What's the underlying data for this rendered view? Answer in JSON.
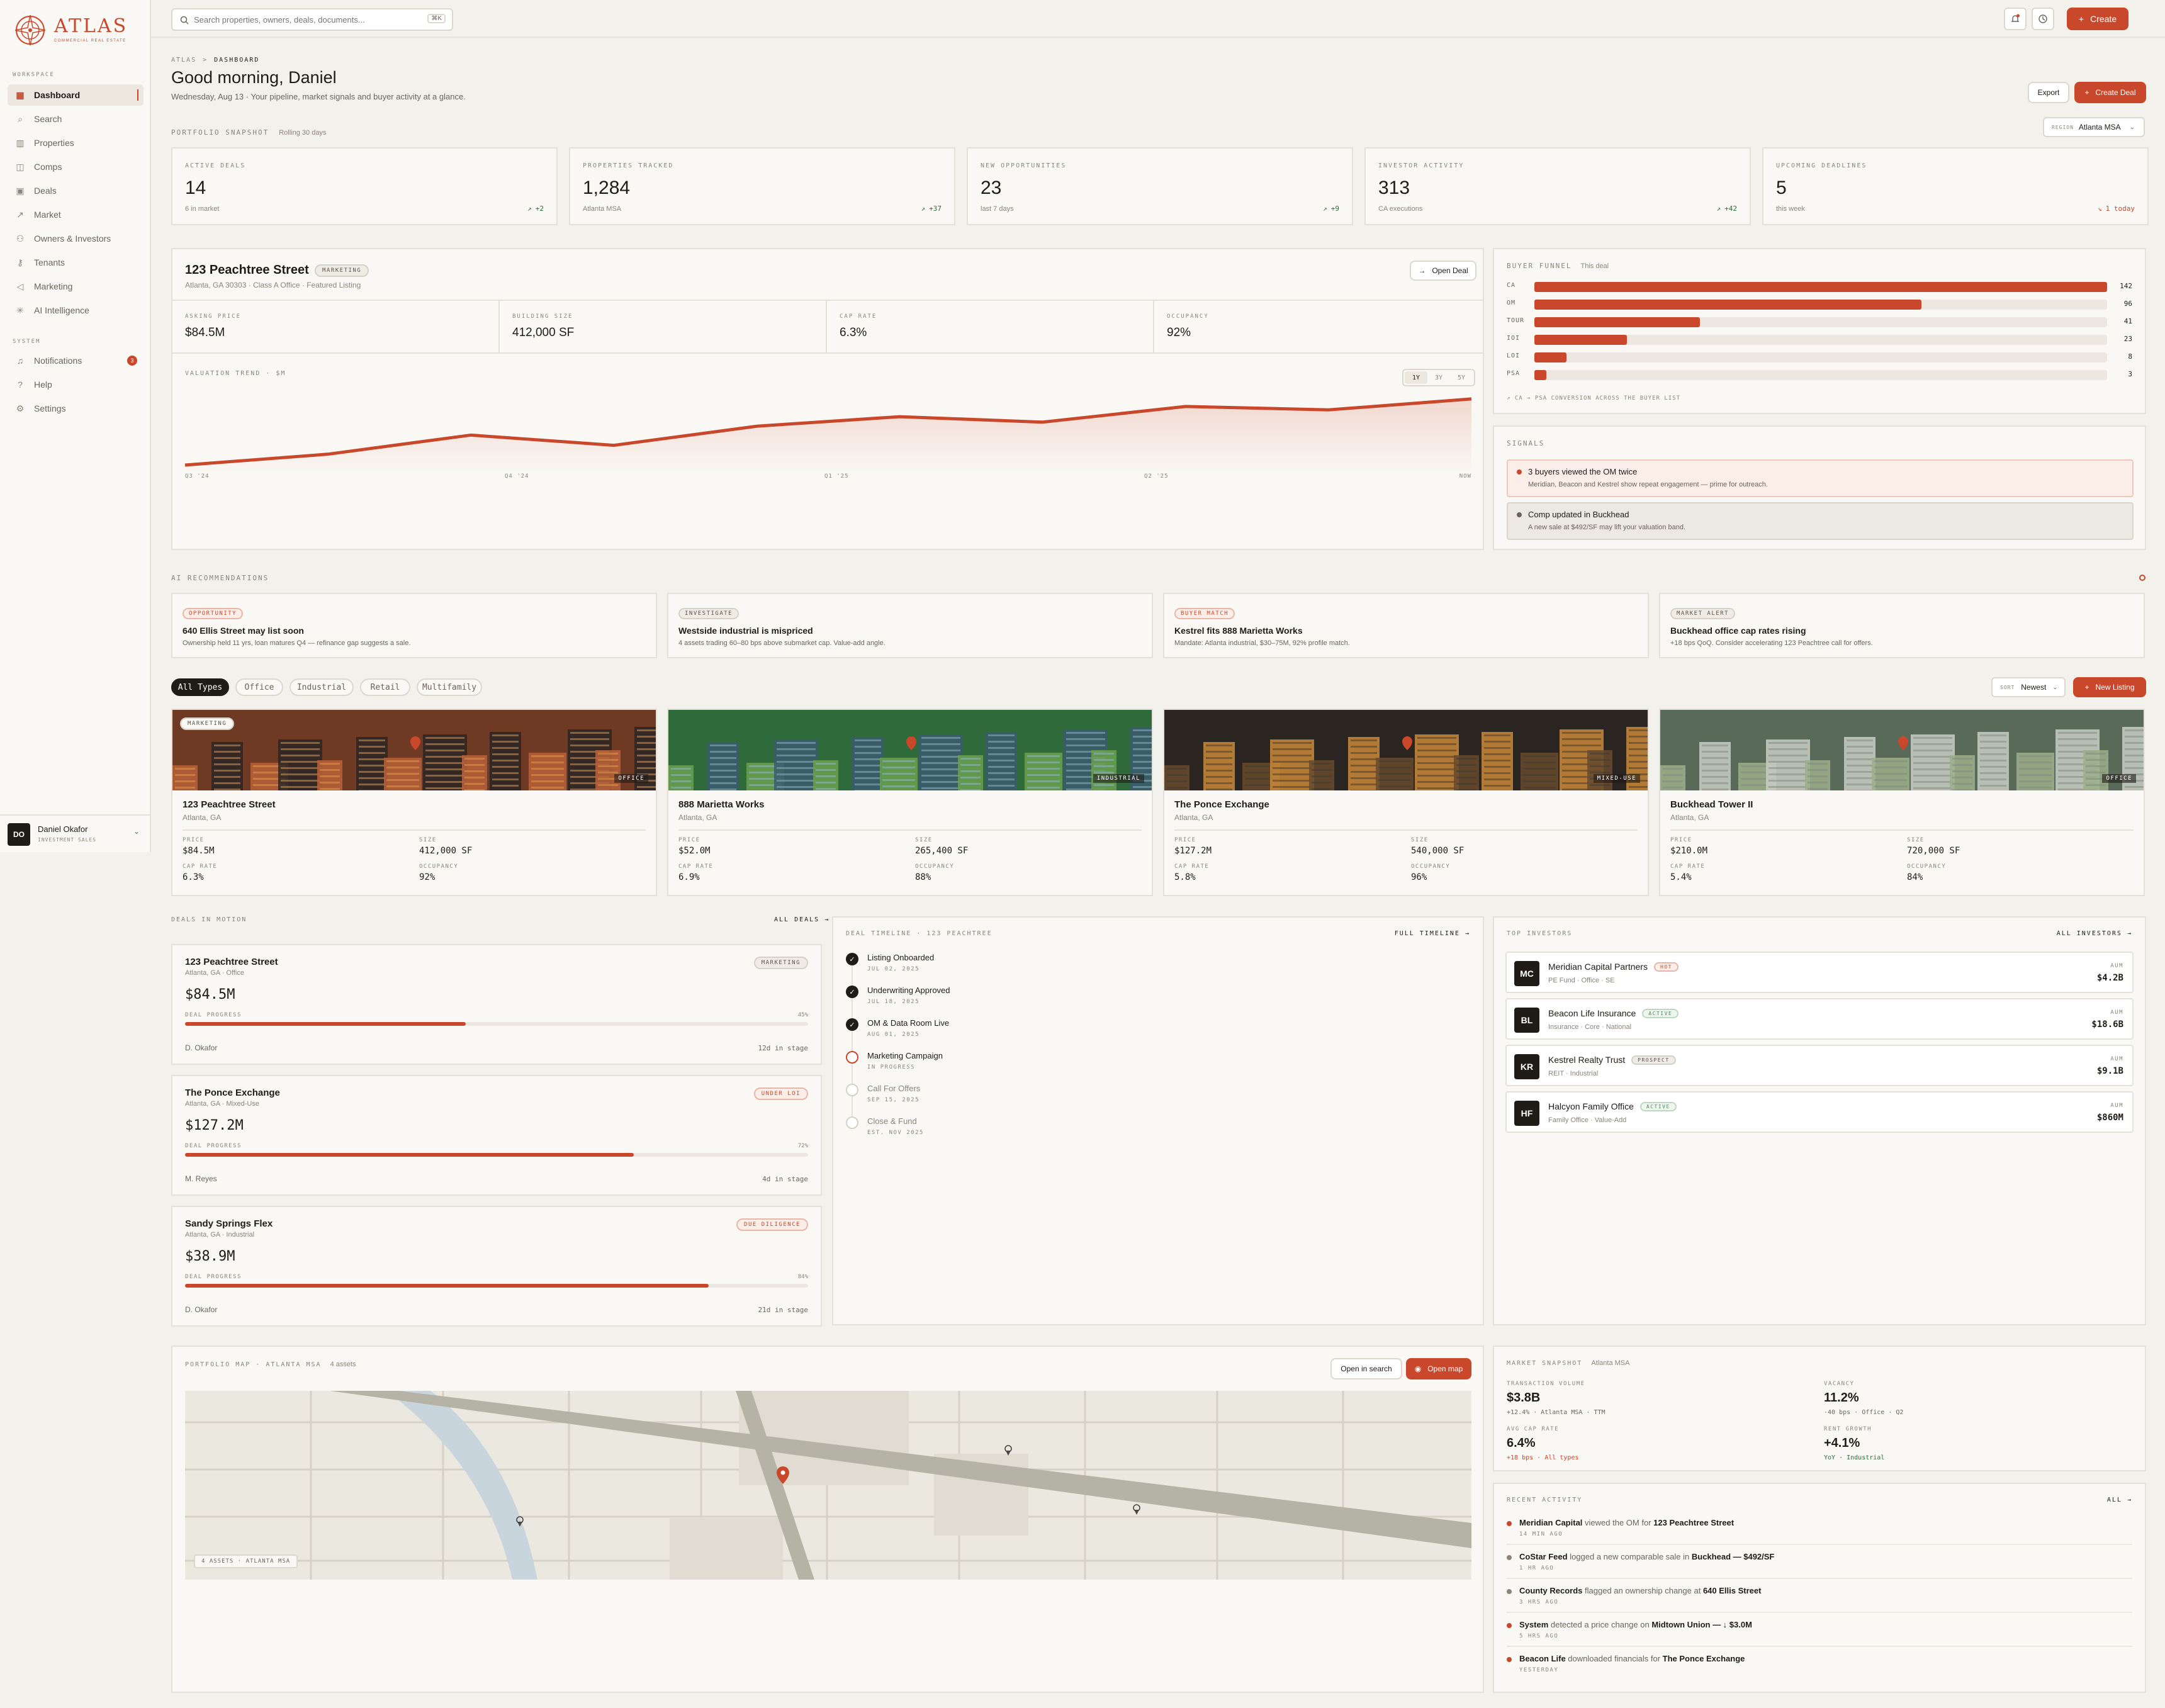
{
  "brand": {
    "name": "ATLAS",
    "tagline": "COMMERCIAL REAL ESTATE"
  },
  "search": {
    "placeholder": "Search properties, owners, deals, documents...",
    "shortcut": "⌘K"
  },
  "topbar": {
    "create_label": "Create"
  },
  "sidebar": {
    "workspace_label": "WORKSPACE",
    "items": [
      {
        "label": "Dashboard",
        "icon": "grid-icon"
      },
      {
        "label": "Search",
        "icon": "search-icon"
      },
      {
        "label": "Properties",
        "icon": "building-icon"
      },
      {
        "label": "Comps",
        "icon": "layers-icon"
      },
      {
        "label": "Deals",
        "icon": "briefcase-icon"
      },
      {
        "label": "Market",
        "icon": "trend-icon"
      },
      {
        "label": "Owners & Investors",
        "icon": "users-icon"
      },
      {
        "label": "Tenants",
        "icon": "key-icon"
      },
      {
        "label": "Marketing",
        "icon": "megaphone-icon"
      },
      {
        "label": "AI Intelligence",
        "icon": "sparkle-icon"
      }
    ],
    "system_label": "SYSTEM",
    "system_items": [
      {
        "label": "Notifications",
        "icon": "bell-icon",
        "badge": "3"
      },
      {
        "label": "Help",
        "icon": "help-icon"
      },
      {
        "label": "Settings",
        "icon": "gear-icon"
      }
    ],
    "user": {
      "initials": "DO",
      "name": "Daniel Okafor",
      "role": "INVESTMENT SALES"
    }
  },
  "header": {
    "breadcrumb_root": "ATLAS",
    "breadcrumb_sep": ">",
    "breadcrumb_page": "DASHBOARD",
    "title": "Good morning, Daniel",
    "subtitle": "Wednesday, Aug 13 · Your pipeline, market signals and buyer activity at a glance.",
    "export_label": "Export",
    "create_deal_label": "Create Deal"
  },
  "snapshot": {
    "label": "PORTFOLIO SNAPSHOT",
    "sub": "Rolling 30 days",
    "region_label": "REGION",
    "region_value": "Atlanta MSA",
    "kpis": [
      {
        "label": "ACTIVE DEALS",
        "value": "14",
        "sub": "6 in market",
        "delta": "+2",
        "neg": false
      },
      {
        "label": "PROPERTIES TRACKED",
        "value": "1,284",
        "sub": "Atlanta MSA",
        "delta": "+37",
        "neg": false
      },
      {
        "label": "NEW OPPORTUNITIES",
        "value": "23",
        "sub": "last 7 days",
        "delta": "+9",
        "neg": false
      },
      {
        "label": "INVESTOR ACTIVITY",
        "value": "313",
        "sub": "CA executions",
        "delta": "+42",
        "neg": false
      },
      {
        "label": "UPCOMING DEADLINES",
        "value": "5",
        "sub": "this week",
        "delta": "1 today",
        "neg": true
      }
    ]
  },
  "featured": {
    "name": "123 Peachtree Street",
    "status": "MARKETING",
    "address": "Atlanta, GA 30303 · Class A Office · Featured Listing",
    "open_label": "Open Deal",
    "metrics": [
      {
        "label": "ASKING PRICE",
        "value": "$84.5M"
      },
      {
        "label": "BUILDING SIZE",
        "value": "412,000 SF"
      },
      {
        "label": "CAP RATE",
        "value": "6.3%"
      },
      {
        "label": "OCCUPANCY",
        "value": "92%"
      }
    ],
    "trend_label": "VALUATION TREND · $M",
    "ranges": [
      "1Y",
      "3Y",
      "5Y"
    ],
    "x_ticks": [
      "Q3 '24",
      "Q4 '24",
      "Q1 '25",
      "Q2 '25",
      "NOW"
    ]
  },
  "chart_data": {
    "type": "area",
    "title": "VALUATION TREND · $M",
    "x": [
      "Q3 '24",
      "",
      "",
      "",
      "",
      "",
      "",
      "",
      "",
      "NOW"
    ],
    "series": [
      {
        "values": [
          70.2,
          71.8,
          74.6,
          73.1,
          75.9,
          77.3,
          76.5,
          78.8,
          78.3,
          79.9
        ]
      }
    ]
  },
  "funnel": {
    "label": "BUYER FUNNEL",
    "sub": "This deal",
    "stages": [
      {
        "name": "CA",
        "value": 142
      },
      {
        "name": "OM",
        "value": 96
      },
      {
        "name": "TOUR",
        "value": 41
      },
      {
        "name": "IOI",
        "value": 23
      },
      {
        "name": "LOI",
        "value": 8
      },
      {
        "name": "PSA",
        "value": 3
      }
    ],
    "footnote": "↗ CA → PSA CONVERSION ACROSS THE BUYER LIST"
  },
  "signals": {
    "label": "SIGNALS",
    "items": [
      {
        "title": "3 buyers viewed the OM twice",
        "desc": "Meridian, Beacon and Kestrel show repeat engagement — prime for outreach."
      },
      {
        "title": "Comp updated in Buckhead",
        "desc": "A new sale at $492/SF may lift your valuation band."
      }
    ]
  },
  "ai": {
    "label": "AI RECOMMENDATIONS",
    "items": [
      {
        "tag": "OPPORTUNITY",
        "title": "640 Ellis Street may list soon",
        "desc": "Ownership held 11 yrs, loan matures Q4 — refinance gap suggests a sale.",
        "red": true
      },
      {
        "tag": "INVESTIGATE",
        "title": "Westside industrial is mispriced",
        "desc": "4 assets trading 60–80 bps above submarket cap. Value-add angle.",
        "red": false
      },
      {
        "tag": "BUYER MATCH",
        "title": "Kestrel fits 888 Marietta Works",
        "desc": "Mandate: Atlanta industrial, $30–75M, 92% profile match.",
        "red": true
      },
      {
        "tag": "MARKET ALERT",
        "title": "Buckhead office cap rates rising",
        "desc": "+18 bps QoQ. Consider accelerating 123 Peachtree call for offers.",
        "red": false
      }
    ]
  },
  "filters": {
    "chips": [
      "All Types",
      "Office",
      "Industrial",
      "Retail",
      "Multifamily"
    ],
    "sort_label": "SORT",
    "sort_value": "Newest",
    "new_label": "New Listing"
  },
  "listings": [
    {
      "name": "123 Peachtree Street",
      "loc": "Atlanta, GA",
      "badge": "MARKETING",
      "type": "OFFICE",
      "price": "$84.5M",
      "size": "412,000 SF",
      "cap": "6.3%",
      "occ": "92%"
    },
    {
      "name": "888 Marietta Works",
      "loc": "Atlanta, GA",
      "badge": "",
      "type": "INDUSTRIAL",
      "price": "$52.0M",
      "size": "265,400 SF",
      "cap": "6.9%",
      "occ": "88%"
    },
    {
      "name": "The Ponce Exchange",
      "loc": "Atlanta, GA",
      "badge": "",
      "type": "MIXED-USE",
      "price": "$127.2M",
      "size": "540,000 SF",
      "cap": "5.8%",
      "occ": "96%"
    },
    {
      "name": "Buckhead Tower II",
      "loc": "Atlanta, GA",
      "badge": "",
      "type": "OFFICE",
      "price": "$210.0M",
      "size": "720,000 SF",
      "cap": "5.4%",
      "occ": "84%"
    }
  ],
  "listing_labels": {
    "price": "PRICE",
    "size": "SIZE",
    "cap": "CAP RATE",
    "occ": "OCCUPANCY"
  },
  "deals": {
    "label": "DEALS IN MOTION",
    "all_label": "ALL DEALS →",
    "progress_label": "DEAL PROGRESS",
    "items": [
      {
        "name": "123 Peachtree Street",
        "loc": "Atlanta, GA · Office",
        "status": "MARKETING",
        "red": false,
        "amount": "$84.5M",
        "progress": 45,
        "progress_text": "45%",
        "owner": "D. Okafor",
        "stage": "12d in stage"
      },
      {
        "name": "The Ponce Exchange",
        "loc": "Atlanta, GA · Mixed-Use",
        "status": "UNDER LOI",
        "red": true,
        "amount": "$127.2M",
        "progress": 72,
        "progress_text": "72%",
        "owner": "M. Reyes",
        "stage": "4d in stage"
      },
      {
        "name": "Sandy Springs Flex",
        "loc": "Atlanta, GA · Industrial",
        "status": "DUE DILIGENCE",
        "red": true,
        "amount": "$38.9M",
        "progress": 84,
        "progress_text": "84%",
        "owner": "D. Okafor",
        "stage": "21d in stage"
      }
    ]
  },
  "timeline": {
    "label": "DEAL TIMELINE · 123 PEACHTREE",
    "full_label": "FULL TIMELINE →",
    "items": [
      {
        "title": "Listing Onboarded",
        "sub": "JUL 02, 2025",
        "state": "done"
      },
      {
        "title": "Underwriting Approved",
        "sub": "JUL 18, 2025",
        "state": "done"
      },
      {
        "title": "OM & Data Room Live",
        "sub": "AUG 01, 2025",
        "state": "done"
      },
      {
        "title": "Marketing Campaign",
        "sub": "IN PROGRESS",
        "state": "current"
      },
      {
        "title": "Call For Offers",
        "sub": "SEP 15, 2025",
        "state": "todo"
      },
      {
        "title": "Close & Fund",
        "sub": "EST. NOV 2025",
        "state": "todo"
      }
    ]
  },
  "investors": {
    "label": "TOP INVESTORS",
    "all_label": "ALL INVESTORS →",
    "aum_label": "AUM",
    "items": [
      {
        "initials": "MC",
        "name": "Meridian Capital Partners",
        "tag": "HOT",
        "kind": "red",
        "type": "PE Fund · Office · SE",
        "aum": "$4.2B"
      },
      {
        "initials": "BL",
        "name": "Beacon Life Insurance",
        "tag": "ACTIVE",
        "kind": "green",
        "type": "Insurance · Core · National",
        "aum": "$18.6B"
      },
      {
        "initials": "KR",
        "name": "Kestrel Realty Trust",
        "tag": "PROSPECT",
        "kind": "grey",
        "type": "REIT · Industrial",
        "aum": "$9.1B"
      },
      {
        "initials": "HF",
        "name": "Halcyon Family Office",
        "tag": "ACTIVE",
        "kind": "green",
        "type": "Family Office · Value-Add",
        "aum": "$860M"
      }
    ]
  },
  "map": {
    "label": "PORTFOLIO MAP · ATLANTA MSA",
    "sub": "4 assets",
    "open_search": "Open in search",
    "open_map": "Open map",
    "legend": "4 ASSETS · ATLANTA MSA"
  },
  "market": {
    "label": "MARKET SNAPSHOT",
    "sub": "Atlanta MSA",
    "items": [
      {
        "label": "TRANSACTION VOLUME",
        "value": "$3.8B",
        "sub": "+12.4% · Atlanta MSA · TTM",
        "color": "#6a645b"
      },
      {
        "label": "VACANCY",
        "value": "11.2%",
        "sub": "-40 bps · Office · Q2",
        "color": "#6a645b"
      },
      {
        "label": "AVG CAP RATE",
        "value": "6.4%",
        "sub": "+18 bps · All types",
        "color": "#c9472a"
      },
      {
        "label": "RENT GROWTH",
        "value": "+4.1%",
        "sub": "YoY · Industrial",
        "color": "#2f6b3a"
      }
    ]
  },
  "activity": {
    "label": "RECENT ACTIVITY",
    "all_label": "ALL →",
    "items": [
      {
        "actor": "Meridian Capital",
        "text": " viewed the OM for ",
        "target": "123 Peachtree Street",
        "time": "14 MIN AGO",
        "red": true
      },
      {
        "actor": "CoStar Feed",
        "text": " logged a new comparable sale in ",
        "target": "Buckhead — $492/SF",
        "time": "1 HR AGO",
        "red": false
      },
      {
        "actor": "County Records",
        "text": " flagged an ownership change at ",
        "target": "640 Ellis Street",
        "time": "3 HRS AGO",
        "red": false
      },
      {
        "actor": "System",
        "text": " detected a price change on ",
        "target": "Midtown Union — ↓ $3.0M",
        "time": "5 HRS AGO",
        "red": true
      },
      {
        "actor": "Beacon Life",
        "text": " downloaded financials for ",
        "target": "The Ponce Exchange",
        "time": "YESTERDAY",
        "red": true
      }
    ]
  }
}
